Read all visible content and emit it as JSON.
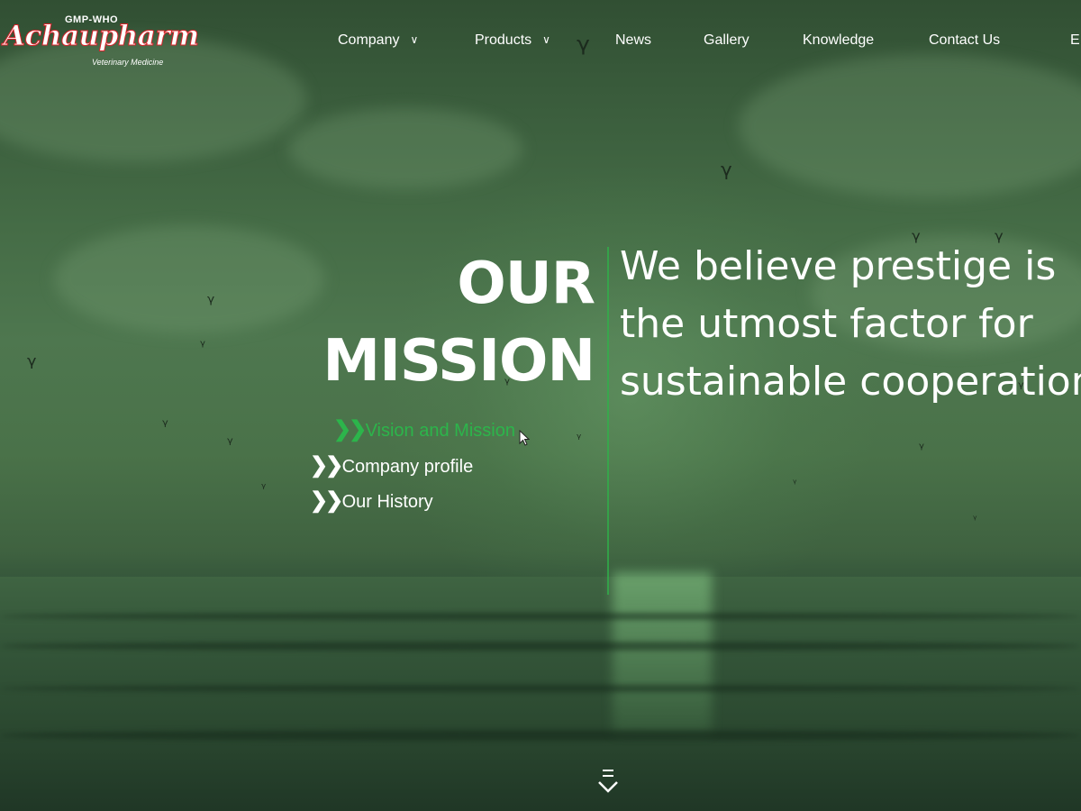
{
  "brand": {
    "badge": "GMP-WHO",
    "name": "Achaupharm",
    "tagline": "Veterinary Medicine"
  },
  "nav": {
    "items": [
      {
        "label": "Company",
        "has_dropdown": true
      },
      {
        "label": "Products",
        "has_dropdown": true
      },
      {
        "label": "News",
        "has_dropdown": false
      },
      {
        "label": "Gallery",
        "has_dropdown": false
      },
      {
        "label": "Knowledge",
        "has_dropdown": false
      },
      {
        "label": "Contact Us",
        "has_dropdown": false
      },
      {
        "label": "E",
        "has_dropdown": false
      }
    ]
  },
  "mission": {
    "title_line1": "OUR",
    "title_line2": "MISSION",
    "statement": "We believe prestige is the utmost factor for sustainable cooperation",
    "submenu": [
      {
        "label": "Vision and Mission",
        "active": true,
        "icon": "double-chevron-right-icon"
      },
      {
        "label": "Company profile",
        "active": false,
        "icon": "double-chevron-right-icon"
      },
      {
        "label": "Our History",
        "active": false,
        "icon": "double-chevron-right-icon"
      }
    ]
  },
  "colors": {
    "accent_green": "#2cb54b",
    "brand_red": "#d8232a",
    "text": "#ffffff"
  },
  "icons": {
    "dropdown": "chevron-down-icon",
    "scroll": "scroll-down-icon"
  }
}
